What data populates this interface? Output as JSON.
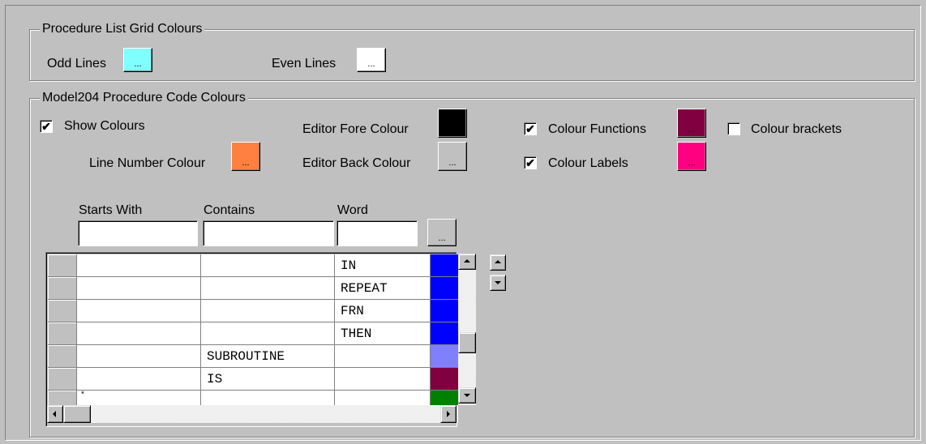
{
  "grid_colours": {
    "title": "Procedure List Grid Colours",
    "odd_label": "Odd Lines",
    "odd_color": "#80ffff",
    "even_label": "Even Lines",
    "even_color": "#ffffff",
    "dots": "..."
  },
  "code_colours": {
    "title": "Model204 Procedure Code Colours",
    "show_colours": {
      "label": "Show Colours",
      "checked": true
    },
    "line_number": {
      "label": "Line Number Colour",
      "color": "#ff8040"
    },
    "editor_fore": {
      "label": "Editor Fore Colour",
      "color": "#000000"
    },
    "editor_back": {
      "label": "Editor Back Colour",
      "color": "#c0c0c0"
    },
    "colour_functions": {
      "label": "Colour Functions",
      "checked": true,
      "color": "#800040"
    },
    "colour_labels": {
      "label": "Colour Labels",
      "checked": true,
      "color": "#ff0080"
    },
    "colour_brackets": {
      "label": "Colour brackets",
      "checked": false
    },
    "dots": "...",
    "check_mark": "✔"
  },
  "filters": {
    "starts_with_label": "Starts With",
    "contains_label": "Contains",
    "word_label": "Word",
    "starts_with_value": "",
    "contains_value": "",
    "word_value": "",
    "browse_dots": "..."
  },
  "grid": {
    "rows": [
      {
        "starts": "",
        "contains": "",
        "word": "IN",
        "color": "#0000ff"
      },
      {
        "starts": "",
        "contains": "",
        "word": "REPEAT",
        "color": "#0000ff"
      },
      {
        "starts": "",
        "contains": "",
        "word": "FRN",
        "color": "#0000ff"
      },
      {
        "starts": "",
        "contains": "",
        "word": "THEN",
        "color": "#0000ff"
      },
      {
        "starts": "",
        "contains": "SUBROUTINE",
        "word": "",
        "color": "#8080ff"
      },
      {
        "starts": "",
        "contains": "IS",
        "word": "",
        "color": "#800040"
      },
      {
        "starts": "*",
        "contains": "",
        "word": "",
        "color": "#008000"
      }
    ]
  }
}
